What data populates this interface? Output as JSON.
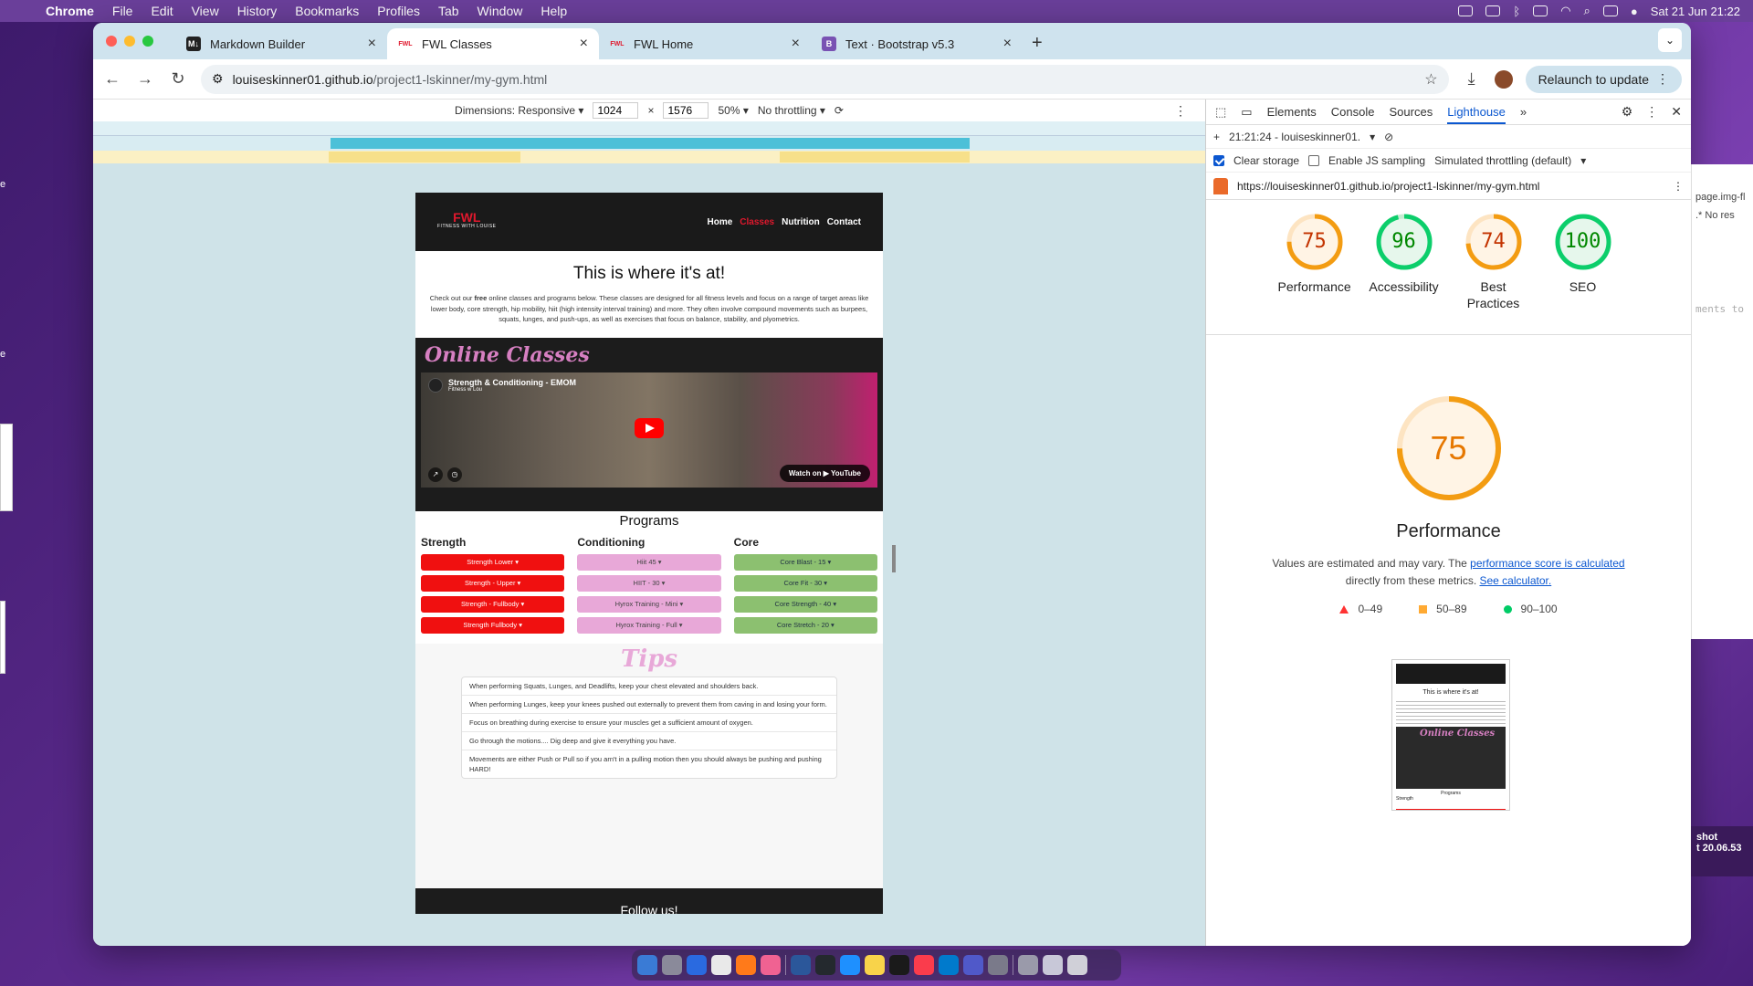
{
  "menubar": {
    "app": "Chrome",
    "items": [
      "File",
      "Edit",
      "View",
      "History",
      "Bookmarks",
      "Profiles",
      "Tab",
      "Window",
      "Help"
    ],
    "datetime": "Sat 21 Jun  21:22"
  },
  "browser": {
    "tabs": [
      {
        "title": "Markdown Builder",
        "favicon": "M↓",
        "favicon_color": "#222222"
      },
      {
        "title": "FWL Classes",
        "favicon": "FWL",
        "favicon_color": "#e0182d",
        "active": true
      },
      {
        "title": "FWL Home",
        "favicon": "FWL",
        "favicon_color": "#e0182d"
      },
      {
        "title": "Text · Bootstrap v5.3",
        "favicon": "B",
        "favicon_color": "#7952b3"
      }
    ],
    "url_host": "louiseskinner01.github.io",
    "url_path": "/project1-lskinner/my-gym.html",
    "relaunch_label": "Relaunch to update"
  },
  "device_toolbar": {
    "dimensions_label": "Dimensions: Responsive ▾",
    "width": "1024",
    "height": "1576",
    "zoom": "50% ▾",
    "throttling": "No throttling ▾"
  },
  "site": {
    "logo": "FWL",
    "logo_sub": "FITNESS WITH LOUISE",
    "nav": [
      "Home",
      "Classes",
      "Nutrition",
      "Contact"
    ],
    "hero_title": "This is where it's at!",
    "hero_text_before": "Check out our ",
    "hero_text_bold": "free",
    "hero_text_after": " online classes and programs below. These classes are designed for all fitness levels and focus on a range of target areas like lower body, core strength, hip mobility, hiit (high intensity interval training) and more. They often involve compound movements such as burpees, squats, lunges, and push-ups, as well as exercises that focus on balance, stability, and plyometrics.",
    "online_title": "Online Classes",
    "video_title": "Strength & Conditioning - EMOM",
    "video_channel": "Fitness w Lou",
    "video_watch": "Watch on ▶ YouTube",
    "programs_title": "Programs",
    "columns": [
      {
        "heading": "Strength",
        "color": "red",
        "buttons": [
          "Strength Lower ▾",
          "Strength - Upper ▾",
          "Strength - Fullbody ▾",
          "Strength Fullbody ▾"
        ]
      },
      {
        "heading": "Conditioning",
        "color": "pink",
        "buttons": [
          "Hiit 45 ▾",
          "HIIT - 30 ▾",
          "Hyrox Training - Mini ▾",
          "Hyrox Training - Full ▾"
        ]
      },
      {
        "heading": "Core",
        "color": "green",
        "buttons": [
          "Core Blast - 15 ▾",
          "Core Fit - 30 ▾",
          "Core Strength - 40 ▾",
          "Core Stretch - 20 ▾"
        ]
      }
    ],
    "tips_title": "Tips",
    "tips": [
      "When performing Squats, Lunges, and Deadlifts, keep your chest elevated and shoulders back.",
      "When performing Lunges, keep your knees pushed out externally to prevent them from caving in and losing your form.",
      "Focus on breathing during exercise to ensure your muscles get a sufficient amount of oxygen.",
      "Go through the motions.... Dig deep and give it everything you have.",
      "Movements are either Push or Pull so if you arn't in a pulling motion then you should always be pushing and pushing HARD!"
    ],
    "footer_text": "Follow us!"
  },
  "devtools": {
    "tabs": [
      "Elements",
      "Console",
      "Sources",
      "Lighthouse"
    ],
    "active_tab": "Lighthouse",
    "report_label": "21:21:24 - louiseskinner01.",
    "clear_storage": "Clear storage",
    "js_sampling": "Enable JS sampling",
    "throttling": "Simulated throttling (default)",
    "report_url": "https://louiseskinner01.github.io/project1-lskinner/my-gym.html",
    "scores": [
      {
        "label": "Performance",
        "value": 75,
        "color": "#e67700"
      },
      {
        "label": "Accessibility",
        "value": 96,
        "color": "#0a8a2a"
      },
      {
        "label": "Best Practices",
        "value": 74,
        "color": "#e67700"
      },
      {
        "label": "SEO",
        "value": 100,
        "color": "#0a8a2a"
      }
    ],
    "detail_title": "Performance",
    "detail_score": 75,
    "detail_text_1": "Values are estimated and may vary. The ",
    "detail_link_1": "performance score is calculated",
    "detail_text_2": " directly from these metrics. ",
    "detail_link_2": "See calculator.",
    "legend": [
      "0–49",
      "50–89",
      "90–100"
    ],
    "thumb_title": "This is where it's at!",
    "thumb_online": "Online Classes",
    "thumb_programs": "Programs",
    "thumb_strength": "Strength"
  },
  "behind_window": {
    "text1": "page.img-fl",
    "text2": ".*",
    "text3": "No res",
    "text4": "ments to",
    "shot": "shot",
    "shot_time": "t 20.06.53"
  }
}
